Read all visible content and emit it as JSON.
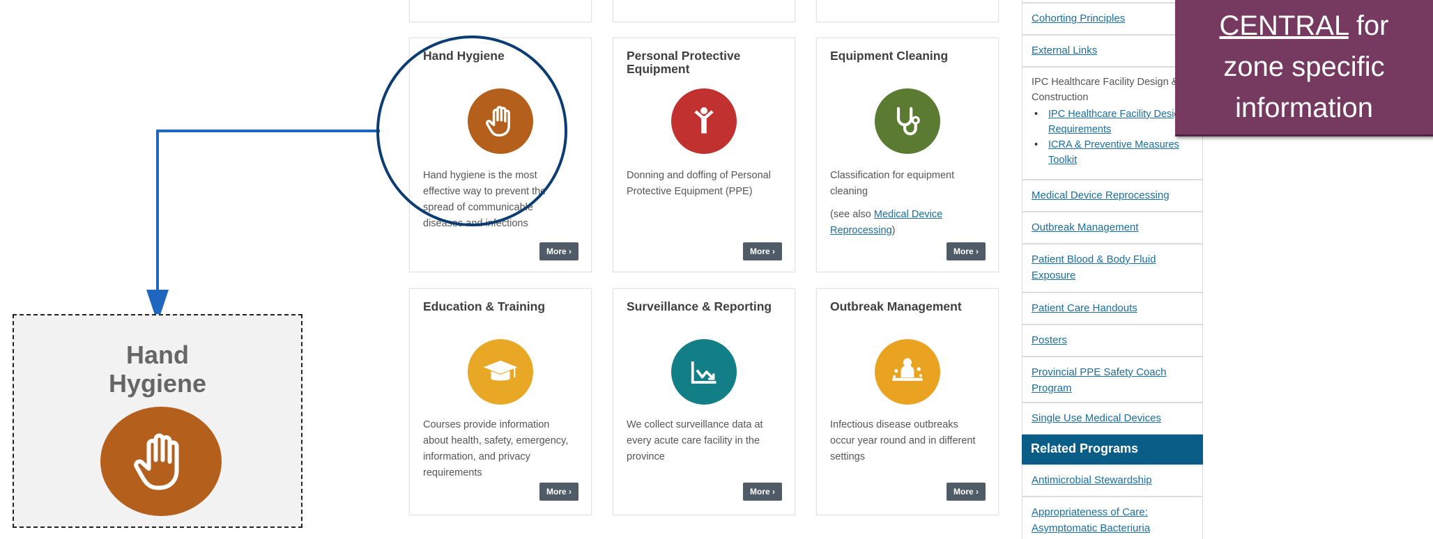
{
  "callout": {
    "title_line1": "Hand",
    "title_line2": "Hygiene",
    "icon": "hand-icon",
    "icon_color": "#b45f1c"
  },
  "cards": [
    {
      "title": "Hand Hygiene",
      "icon": "hand-icon",
      "color": "#b45f1c",
      "description": "Hand hygiene is the most effective way to prevent the spread of communicable diseases and infections",
      "more": "More ›"
    },
    {
      "title": "Personal Protective Equipment",
      "icon": "person-icon",
      "color": "#c0312f",
      "description": "Donning and doffing of Personal Protective Equipment (PPE)",
      "more": "More ›"
    },
    {
      "title": "Equipment Cleaning",
      "icon": "stethoscope-icon",
      "color": "#5b7a32",
      "description": "Classification for equipment cleaning",
      "see_also_prefix": "(see also ",
      "see_also_link": "Medical Device Reprocessing",
      "see_also_suffix": ")",
      "more": "More ›"
    },
    {
      "title": "Education & Training",
      "icon": "graduation-cap-icon",
      "color": "#e8a825",
      "description": "Courses provide information about health, safety, emergency, information, and privacy requirements",
      "more": "More ›"
    },
    {
      "title": "Surveillance & Reporting",
      "icon": "chart-icon",
      "color": "#127f86",
      "description": "We collect surveillance data at every acute care facility in the province",
      "more": "More ›"
    },
    {
      "title": "Outbreak Management",
      "icon": "outbreak-icon",
      "color": "#eaa221",
      "description": "Infectious disease outbreaks occur year round and in different settings",
      "more": "More ›"
    }
  ],
  "sidebar": {
    "items": [
      "Cohorting Principles",
      "External Links",
      "IPC Healthcare Facility Design & Construction",
      "Medical Device Reprocessing",
      "Outbreak Management",
      "Patient Blood & Body Fluid Exposure",
      "Patient Care Handouts",
      "Posters",
      "Provincial PPE Safety Coach Program",
      "Single Use Medical Devices"
    ],
    "sub_items": [
      "IPC Healthcare Facility Design Requirements",
      "ICRA & Preventive Measures Toolkit"
    ],
    "related_header": "Related Programs",
    "related_items": [
      "Antimicrobial Stewardship",
      "Appropriateness of Care: Asymptomatic Bacteriuria"
    ],
    "header_color": "#0a5d86",
    "link_color": "#1a6ea0"
  },
  "banner": {
    "line1_underlined": "CENTRAL",
    "line1_rest": " for",
    "line2": "zone specific",
    "line3": "information",
    "color": "#76395f"
  },
  "annotation": {
    "circle_color": "#0b3d73",
    "arrow_color": "#1f66bf"
  }
}
